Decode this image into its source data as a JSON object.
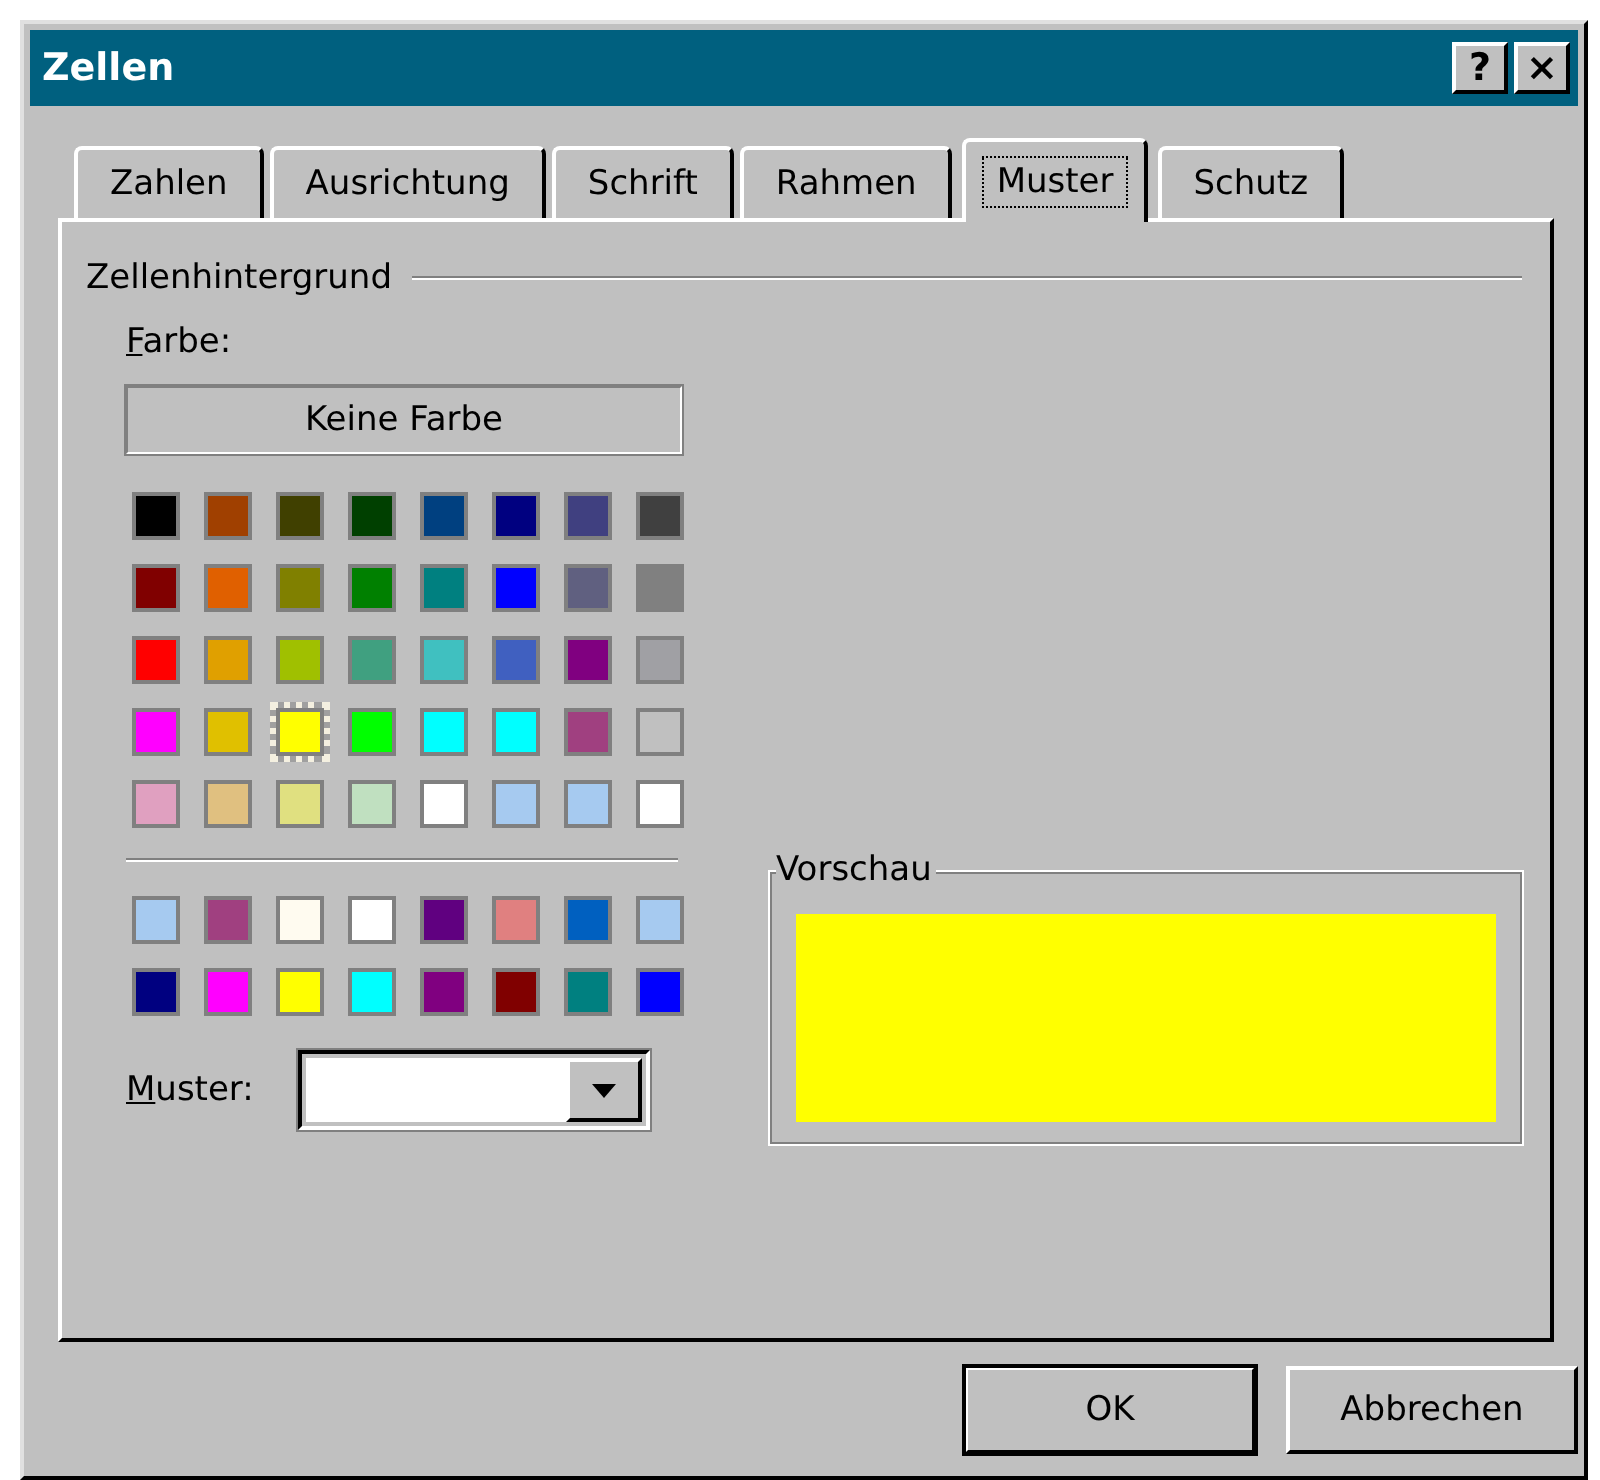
{
  "window": {
    "title": "Zellen",
    "title_buttons": [
      "?",
      "×"
    ]
  },
  "tabs": [
    {
      "label": "Zahlen",
      "selected": false
    },
    {
      "label": "Ausrichtung",
      "selected": false
    },
    {
      "label": "Schrift",
      "selected": false
    },
    {
      "label": "Rahmen",
      "selected": false
    },
    {
      "label": "Muster",
      "selected": true
    },
    {
      "label": "Schutz",
      "selected": false
    }
  ],
  "group": {
    "title": "Zellenhintergrund"
  },
  "color_label": "Farbe:",
  "no_color_button": "Keine Farbe",
  "palette": [
    [
      {
        "color": "#000000",
        "selected": false
      },
      {
        "color": "#a04000",
        "selected": false
      },
      {
        "color": "#404000",
        "selected": false
      },
      {
        "color": "#004000",
        "selected": false
      },
      {
        "color": "#004080",
        "selected": false
      },
      {
        "color": "#000080",
        "selected": false
      },
      {
        "color": "#404080",
        "selected": false
      },
      {
        "color": "#404040",
        "selected": false
      }
    ],
    [
      {
        "color": "#800000",
        "selected": false
      },
      {
        "color": "#e06000",
        "selected": false
      },
      {
        "color": "#808000",
        "selected": false
      },
      {
        "color": "#008000",
        "selected": false
      },
      {
        "color": "#008080",
        "selected": false
      },
      {
        "color": "#0000ff",
        "selected": false
      },
      {
        "color": "#606080",
        "selected": false
      },
      {
        "color": "#808080",
        "selected": false
      }
    ],
    [
      {
        "color": "#ff0000",
        "selected": false
      },
      {
        "color": "#e0a000",
        "selected": false
      },
      {
        "color": "#a0c000",
        "selected": false
      },
      {
        "color": "#40a080",
        "selected": false
      },
      {
        "color": "#40c0c0",
        "selected": false
      },
      {
        "color": "#4060c0",
        "selected": false
      },
      {
        "color": "#800080",
        "selected": false
      },
      {
        "color": "#a0a0a4",
        "selected": false
      }
    ],
    [
      {
        "color": "#ff00ff",
        "selected": false
      },
      {
        "color": "#e0c000",
        "selected": false
      },
      {
        "color": "#ffff00",
        "selected": true
      },
      {
        "color": "#00ff00",
        "selected": false
      },
      {
        "color": "#00ffff",
        "selected": false
      },
      {
        "color": "#00ffff",
        "selected": false
      },
      {
        "color": "#a04080",
        "selected": false
      },
      {
        "color": "#c0c0c0",
        "selected": false
      }
    ],
    [
      {
        "color": "#e0a0c0",
        "selected": false
      },
      {
        "color": "#e0c080",
        "selected": false
      },
      {
        "color": "#e0e080",
        "selected": false
      },
      {
        "color": "#c0e0c0",
        "selected": false
      },
      {
        "color": "#ffffff",
        "selected": false
      },
      {
        "color": "#a6caf0",
        "selected": false
      },
      {
        "color": "#a6caf0",
        "selected": false
      },
      {
        "color": "#ffffff",
        "selected": false
      }
    ]
  ],
  "extra_palette": [
    [
      {
        "color": "#a6caf0",
        "selected": false
      },
      {
        "color": "#a04080",
        "selected": false
      },
      {
        "color": "#fffbf0",
        "selected": false
      },
      {
        "color": "#ffffff",
        "selected": false
      },
      {
        "color": "#600080",
        "selected": false
      },
      {
        "color": "#e08080",
        "selected": false
      },
      {
        "color": "#0060c0",
        "selected": false
      },
      {
        "color": "#a6caf0",
        "selected": false
      }
    ],
    [
      {
        "color": "#000080",
        "selected": false
      },
      {
        "color": "#ff00ff",
        "selected": false
      },
      {
        "color": "#ffff00",
        "selected": false
      },
      {
        "color": "#00ffff",
        "selected": false
      },
      {
        "color": "#800080",
        "selected": false
      },
      {
        "color": "#800000",
        "selected": false
      },
      {
        "color": "#008080",
        "selected": false
      },
      {
        "color": "#0000ff",
        "selected": false
      }
    ]
  ],
  "pattern": {
    "label": "Muster:"
  },
  "preview": {
    "title": "Vorschau",
    "color": "#ffff00"
  },
  "buttons": [
    {
      "label": "OK",
      "default": true
    },
    {
      "label": "Abbrechen",
      "default": false
    }
  ]
}
